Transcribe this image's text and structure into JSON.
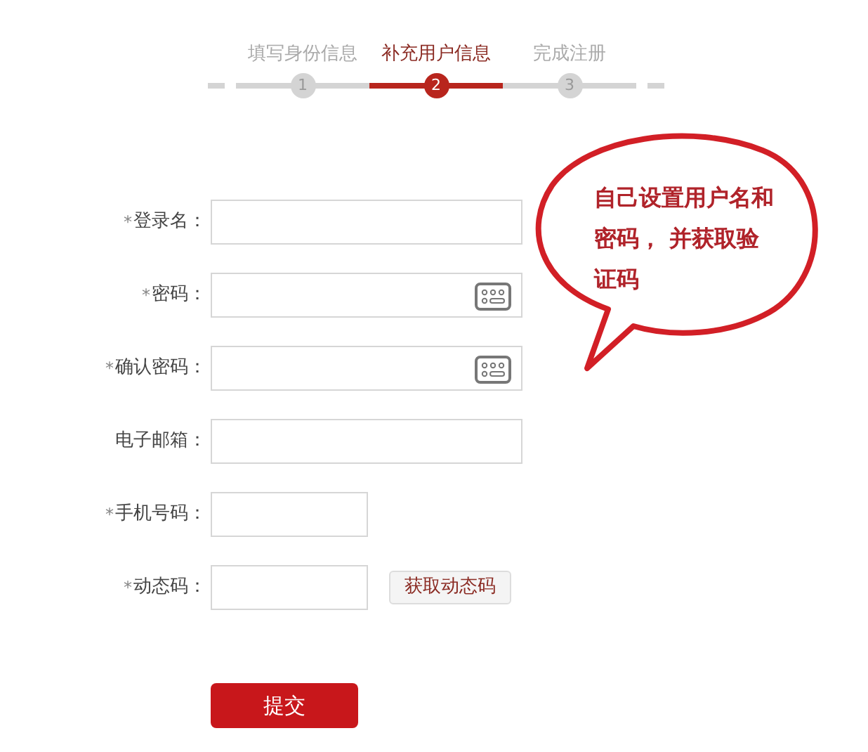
{
  "steps": [
    {
      "label": "填写身份信息",
      "number": "1",
      "selected": false
    },
    {
      "label": "补充用户信息",
      "number": "2",
      "selected": true
    },
    {
      "label": "完成注册",
      "number": "3",
      "selected": false
    }
  ],
  "fields": [
    {
      "required_mark": "*",
      "label": "登录名：",
      "kind": "wide",
      "keyboard_icon": false
    },
    {
      "required_mark": "*",
      "label": "密码：",
      "kind": "wide",
      "keyboard_icon": true
    },
    {
      "required_mark": "*",
      "label": "确认密码：",
      "kind": "wide",
      "keyboard_icon": true
    },
    {
      "label": "电子邮箱：",
      "kind": "wide",
      "keyboard_icon": false
    },
    {
      "required_mark": "*",
      "label": "手机号码：",
      "kind": "narrow",
      "keyboard_icon": false
    },
    {
      "required_mark": "*",
      "label": "动态码：",
      "kind": "narrow",
      "keyboard_icon": false,
      "button": "获取动态码"
    }
  ],
  "submit": "提交",
  "callout": "自己设置用户名和密码， 并获取验证码"
}
